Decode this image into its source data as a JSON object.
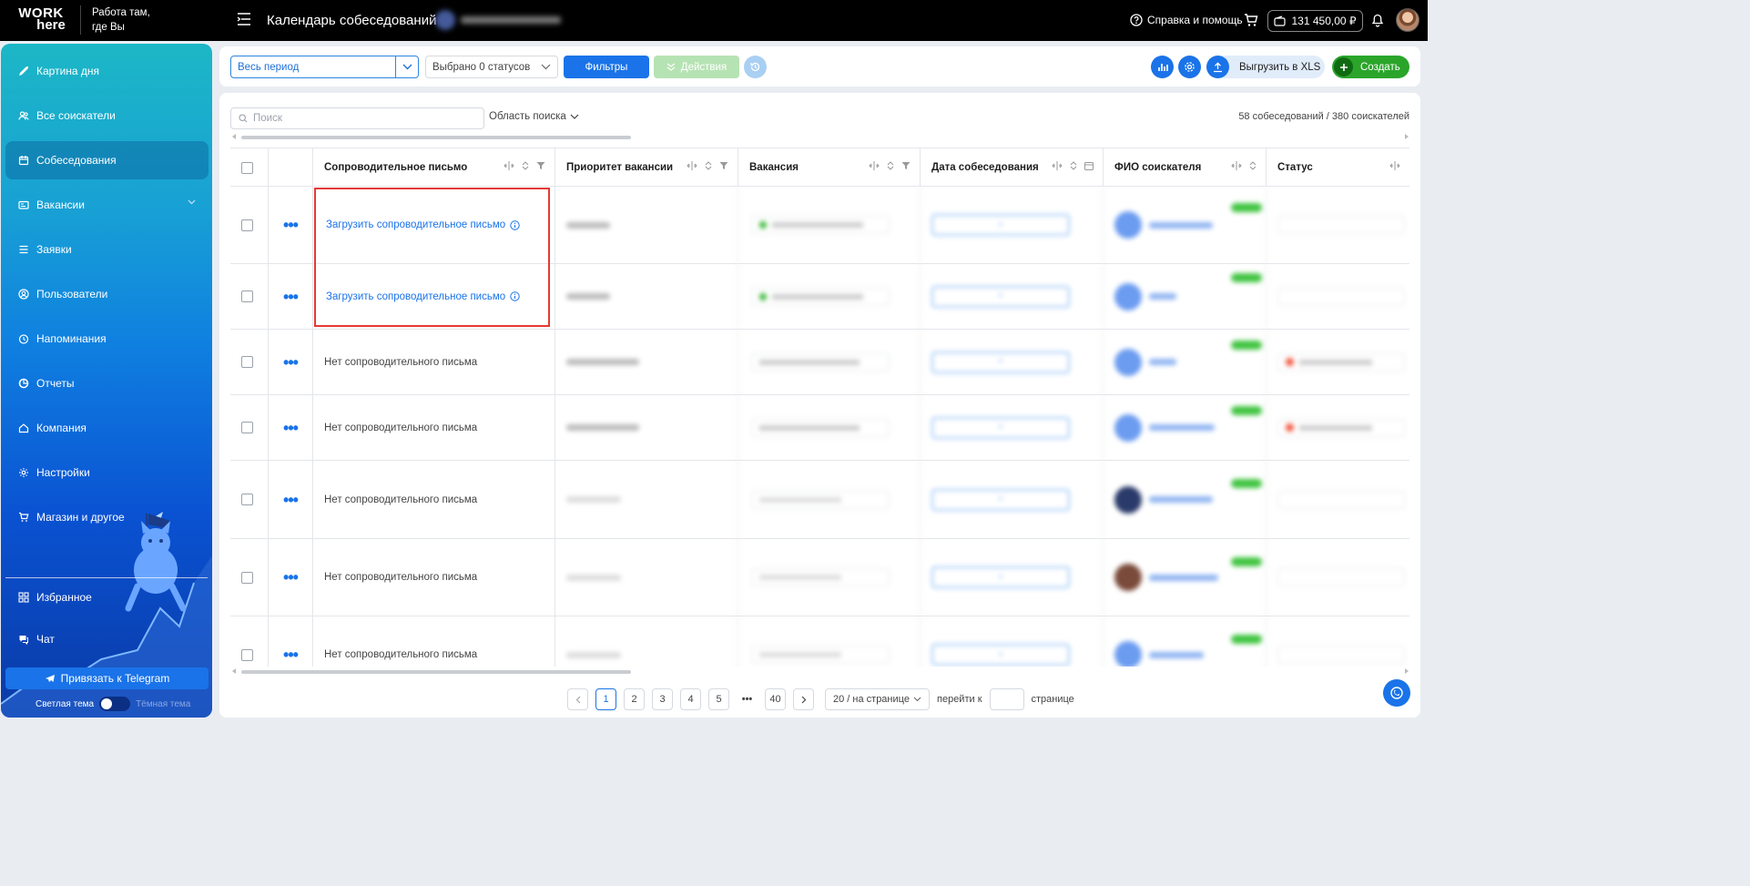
{
  "header": {
    "logo_line1": "WORK",
    "logo_line2": "here",
    "slogan_line1": "Работа там,",
    "slogan_line2": "где Вы",
    "title": "Календарь собеседований",
    "help_label": "Справка и помощь",
    "balance": "131 450,00 ₽"
  },
  "sidebar": {
    "items": [
      {
        "label": "Картина дня",
        "icon": "rocket-icon"
      },
      {
        "label": "Все соискатели",
        "icon": "users-icon"
      },
      {
        "label": "Собеседования",
        "icon": "calendar-icon",
        "active": true
      },
      {
        "label": "Вакансии",
        "icon": "vacancy-icon"
      },
      {
        "label": "Заявки",
        "icon": "list-icon"
      },
      {
        "label": "Пользователи",
        "icon": "user-circle-icon"
      },
      {
        "label": "Напоминания",
        "icon": "clock-icon"
      },
      {
        "label": "Отчеты",
        "icon": "pie-chart-icon"
      },
      {
        "label": "Компания",
        "icon": "home-icon"
      },
      {
        "label": "Настройки",
        "icon": "gear-icon"
      },
      {
        "label": "Магазин и другое",
        "icon": "cart-icon"
      }
    ],
    "favorites_label": "Избранное",
    "chat_label": "Чат",
    "telegram_button": "Привязать к Telegram",
    "theme_light": "Светлая тема",
    "theme_dark": "Тёмная тема"
  },
  "toolbar": {
    "period_value": "Весь период",
    "statuses_value": "Выбрано 0 статусов",
    "filters_label": "Фильтры",
    "actions_label": "Действия",
    "export_label": "Выгрузить в XLS",
    "create_label": "Создать"
  },
  "table_area": {
    "search_placeholder": "Поиск",
    "search_scope_label": "Область поиска",
    "counter": "58 собеседований / 380 соискателей",
    "columns": [
      "Сопроводительное письмо",
      "Приоритет вакансии",
      "Вакансия",
      "Дата собеседования",
      "ФИО соискателя",
      "Статус"
    ],
    "rows": [
      {
        "cover": "Загрузить сопроводительное письмо",
        "upload": true
      },
      {
        "cover": "Загрузить сопроводительное письмо",
        "upload": true
      },
      {
        "cover": "Нет сопроводительного письма",
        "upload": false
      },
      {
        "cover": "Нет сопроводительного письма",
        "upload": false
      },
      {
        "cover": "Нет сопроводительного письма",
        "upload": false
      },
      {
        "cover": "Нет сопроводительного письма",
        "upload": false
      },
      {
        "cover": "Нет сопроводительного письма",
        "upload": false
      }
    ]
  },
  "pagination": {
    "pages": [
      "1",
      "2",
      "3",
      "4",
      "5"
    ],
    "ellipsis": "•••",
    "last_page": "40",
    "current_page": "1",
    "per_page": "20 / на странице",
    "goto_prefix": "перейти к",
    "goto_suffix": "странице"
  },
  "colors": {
    "accent": "#1a73e8",
    "create": "#2aa52a",
    "highlight_box": "#e53935"
  }
}
